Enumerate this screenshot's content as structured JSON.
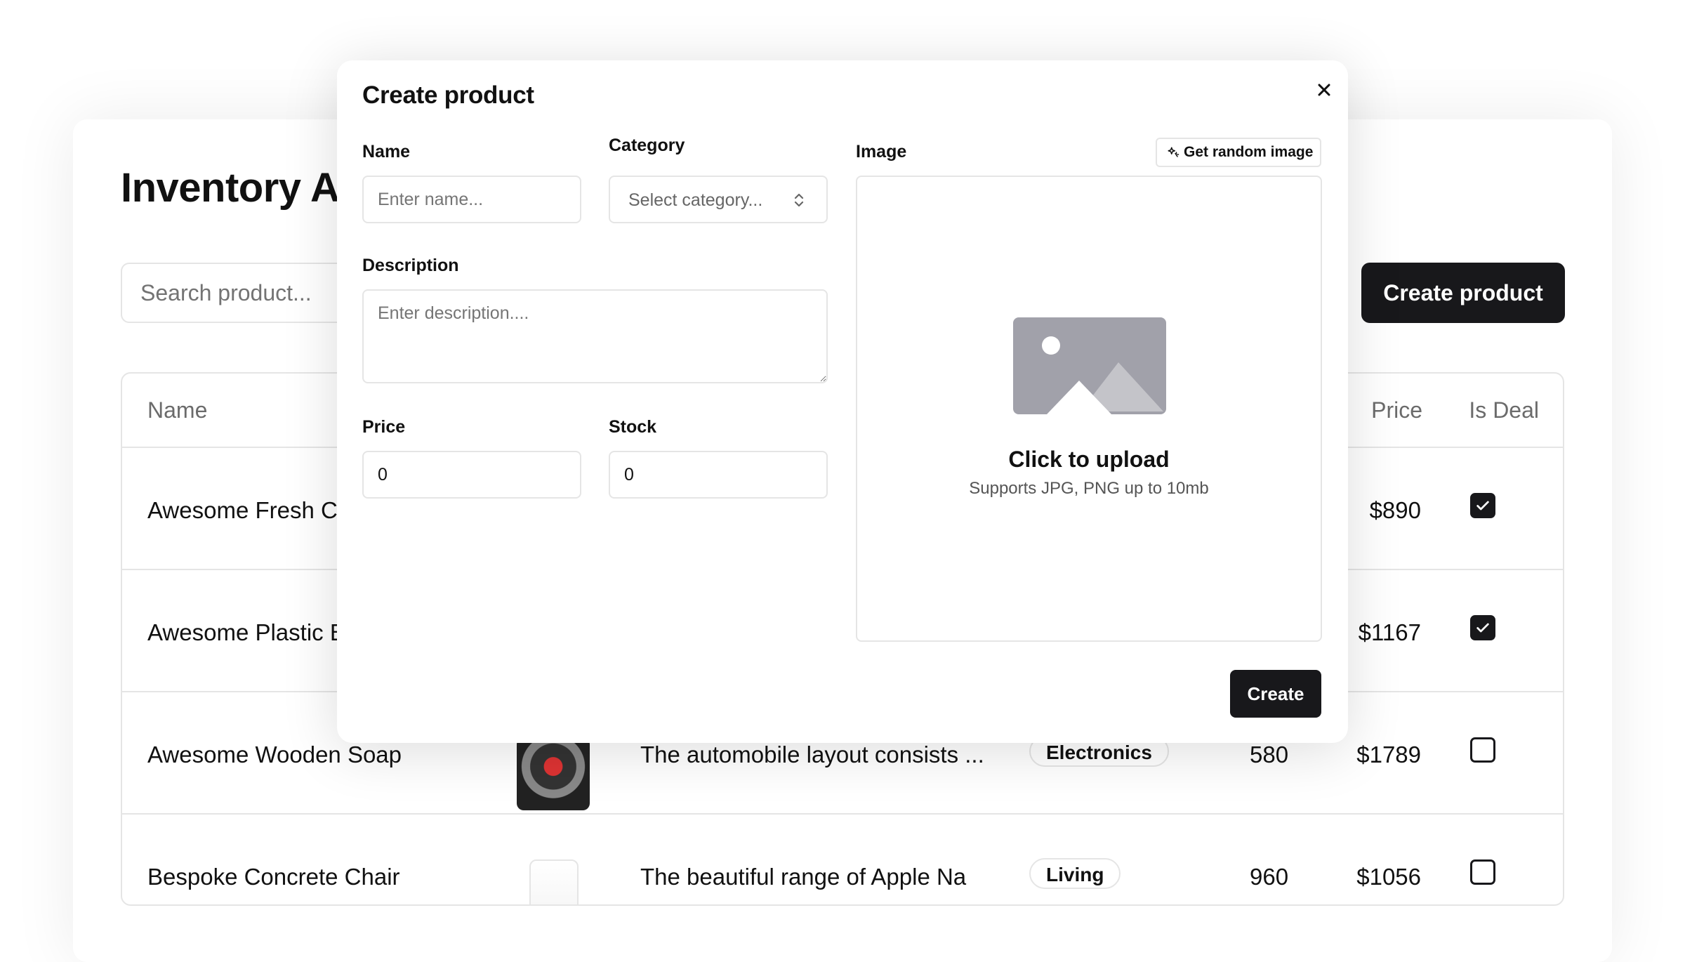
{
  "app": {
    "title": "Inventory Ap",
    "search_placeholder": "Search product...",
    "create_label": "Create product"
  },
  "table": {
    "headers": {
      "name": "Name",
      "price": "Price",
      "is_deal": "Is Deal"
    },
    "rows": [
      {
        "name": "Awesome Fresh Ch",
        "description": "",
        "category": "",
        "stock": "",
        "price": "$890",
        "is_deal": true
      },
      {
        "name": "Awesome Plastic B",
        "description": "",
        "category": "",
        "stock": "",
        "price": "$1167",
        "is_deal": true
      },
      {
        "name": "Awesome Wooden Soap",
        "description": "The automobile layout consists ...",
        "category": "Electronics",
        "stock": "580",
        "price": "$1789",
        "is_deal": false
      },
      {
        "name": "Bespoke Concrete Chair",
        "description": "The beautiful range of Apple Na",
        "category": "Living",
        "stock": "960",
        "price": "$1056",
        "is_deal": false
      }
    ]
  },
  "modal": {
    "title": "Create product",
    "name_label": "Name",
    "name_placeholder": "Enter name...",
    "category_label": "Category",
    "category_placeholder": "Select category...",
    "description_label": "Description",
    "description_placeholder": "Enter description....",
    "price_label": "Price",
    "price_value": "0",
    "stock_label": "Stock",
    "stock_value": "0",
    "image_label": "Image",
    "random_image_label": "Get random image",
    "upload_title": "Click to upload",
    "upload_subtitle": "Supports JPG, PNG up to 10mb",
    "submit_label": "Create"
  },
  "icons": {
    "close": "close-icon",
    "sparkle": "sparkle-icon",
    "chevrons": "chevron-up-down-icon",
    "image_placeholder": "image-placeholder-icon",
    "checkbox_checked": "check-icon"
  },
  "colors": {
    "primary": "#18181b",
    "border": "#e5e5e5",
    "muted_text": "#737373",
    "placeholder_art": "#a1a1aa"
  }
}
